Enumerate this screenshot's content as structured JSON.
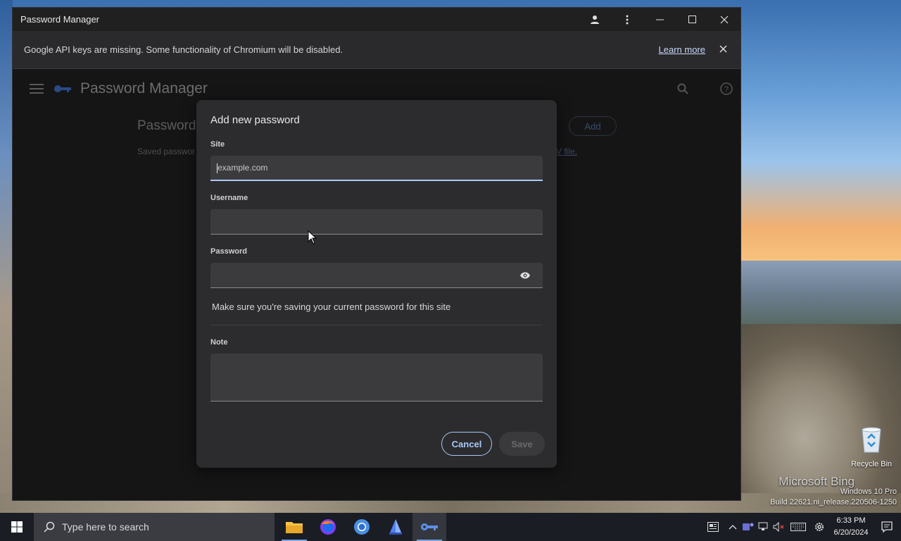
{
  "window": {
    "title": "Password Manager"
  },
  "infobar": {
    "message": "Google API keys are missing. Some functionality of Chromium will be disabled.",
    "learn_more": "Learn more"
  },
  "app": {
    "title": "Password Manager",
    "passwords_heading": "Passwords",
    "saved_text": "Saved passwor",
    "csv_link": "V file.",
    "add_button": "Add"
  },
  "dialog": {
    "title": "Add new password",
    "site_label": "Site",
    "site_placeholder": "example.com",
    "username_label": "Username",
    "password_label": "Password",
    "hint": "Make sure you're saving your current password for this site",
    "note_label": "Note",
    "cancel": "Cancel",
    "save": "Save"
  },
  "desktop": {
    "recycle_bin": "Recycle Bin",
    "bing": "Microsoft Bing",
    "os_line": "Windows 10 Pro",
    "build_line": "Build 22621.ni_release.220506-1250"
  },
  "taskbar": {
    "search_placeholder": "Type here to search",
    "time": "6:33 PM",
    "date": "6/20/2024"
  },
  "colors": {
    "accent": "#a8c7fa",
    "dialog_bg": "#2c2c2e"
  }
}
